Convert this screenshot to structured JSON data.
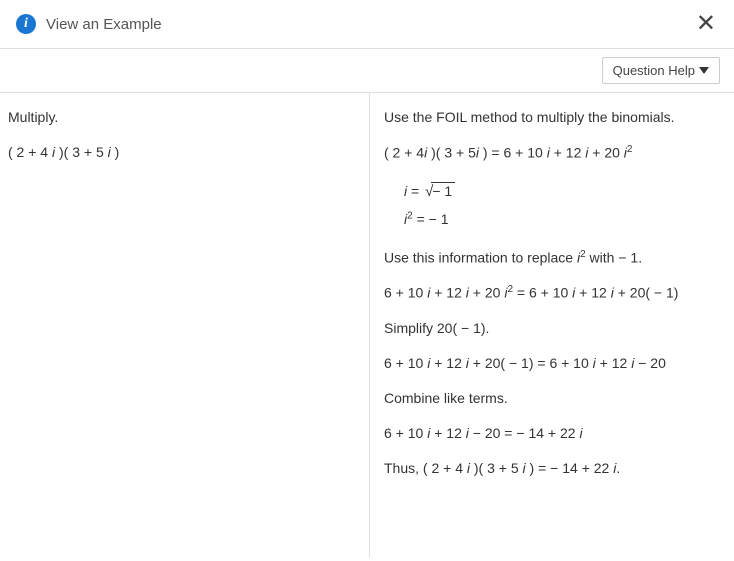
{
  "header": {
    "title": "View an Example",
    "info_icon_char": "i",
    "close_char": "✕"
  },
  "toolbar": {
    "help_label": "Question Help"
  },
  "left": {
    "instruction": "Multiply.",
    "expression_a": "( 2 + 4",
    "expression_i1": " i ",
    "expression_b": ")( 3 + 5",
    "expression_i2": " i",
    "expression_c": " )"
  },
  "right": {
    "step1": "Use the FOIL method to multiply the binomials.",
    "eq1_a": "( 2 + 4",
    "eq1_b": " )( 3 + 5",
    "eq1_c": " ) = 6 + 10",
    "eq1_d": " + 12",
    "eq1_e": " + 20",
    "def_i_eq": " = ",
    "def_neg1": "− 1",
    "def_i2_eq": " =  − 1",
    "step2_a": "Use this information to replace ",
    "step2_b": " with  − 1.",
    "eq2_a": "6 + 10",
    "eq2_b": " + 12",
    "eq2_c": " + 20",
    "eq2_d": " = 6 + 10",
    "eq2_e": " + 12",
    "eq2_f": " + 20( − 1)",
    "step3": "Simplify 20( − 1).",
    "eq3_a": "6 + 10",
    "eq3_b": " + 12",
    "eq3_c": " + 20( − 1) = 6 + 10",
    "eq3_d": " + 12",
    "eq3_e": " − 20",
    "step4": "Combine like terms.",
    "eq4_a": "6 + 10",
    "eq4_b": " + 12",
    "eq4_c": " − 20 =  − 14 + 22",
    "final_a": "Thus, ( 2 + 4",
    "final_b": " )( 3 + 5",
    "final_c": " ) =  − 14 + 22",
    "final_d": ".",
    "i": "i",
    "sup2": "2"
  }
}
